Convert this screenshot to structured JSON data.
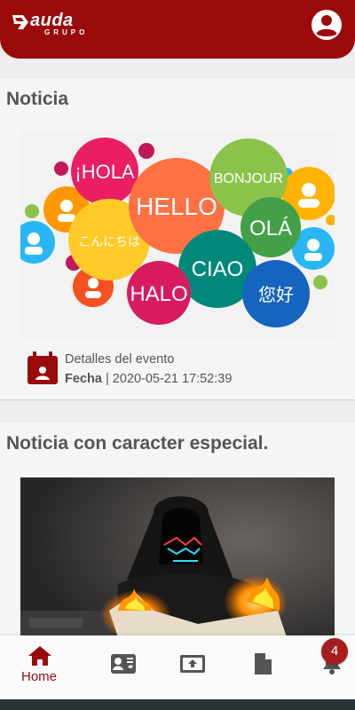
{
  "header": {
    "logo_text": "auda",
    "logo_subtext": "GRUPO",
    "brand_color": "#9b0a0a",
    "account_icon": "account-circle-icon"
  },
  "feed": {
    "cards": [
      {
        "title": "Noticia",
        "image_icon": "languages-speech-bubbles-image",
        "image_words": [
          "¡HOLA",
          "HELLO",
          "BONJOUR",
          "こんにちは",
          "OLÁ",
          "CIAO",
          "HALO",
          "您好"
        ],
        "event": {
          "icon": "calendar-event-icon",
          "title": "Detalles del evento",
          "date_label": "Fecha",
          "separator": "|",
          "date_value": "2020-05-21 17:52:39"
        }
      },
      {
        "title": "Noticia con caracter especial.",
        "image_icon": "hooded-figure-burning-newspaper-photo"
      }
    ]
  },
  "bottom_nav": {
    "items": [
      {
        "label": "Home",
        "icon": "home-icon",
        "active": true
      },
      {
        "label": "",
        "icon": "contacts-icon",
        "active": false
      },
      {
        "label": "",
        "icon": "upload-screen-icon",
        "active": false
      },
      {
        "label": "",
        "icon": "document-icon",
        "active": false
      },
      {
        "label": "",
        "icon": "bell-icon",
        "active": false
      }
    ],
    "notification_count": "4",
    "active_color": "#9b0a0a",
    "inactive_color": "#555555"
  }
}
